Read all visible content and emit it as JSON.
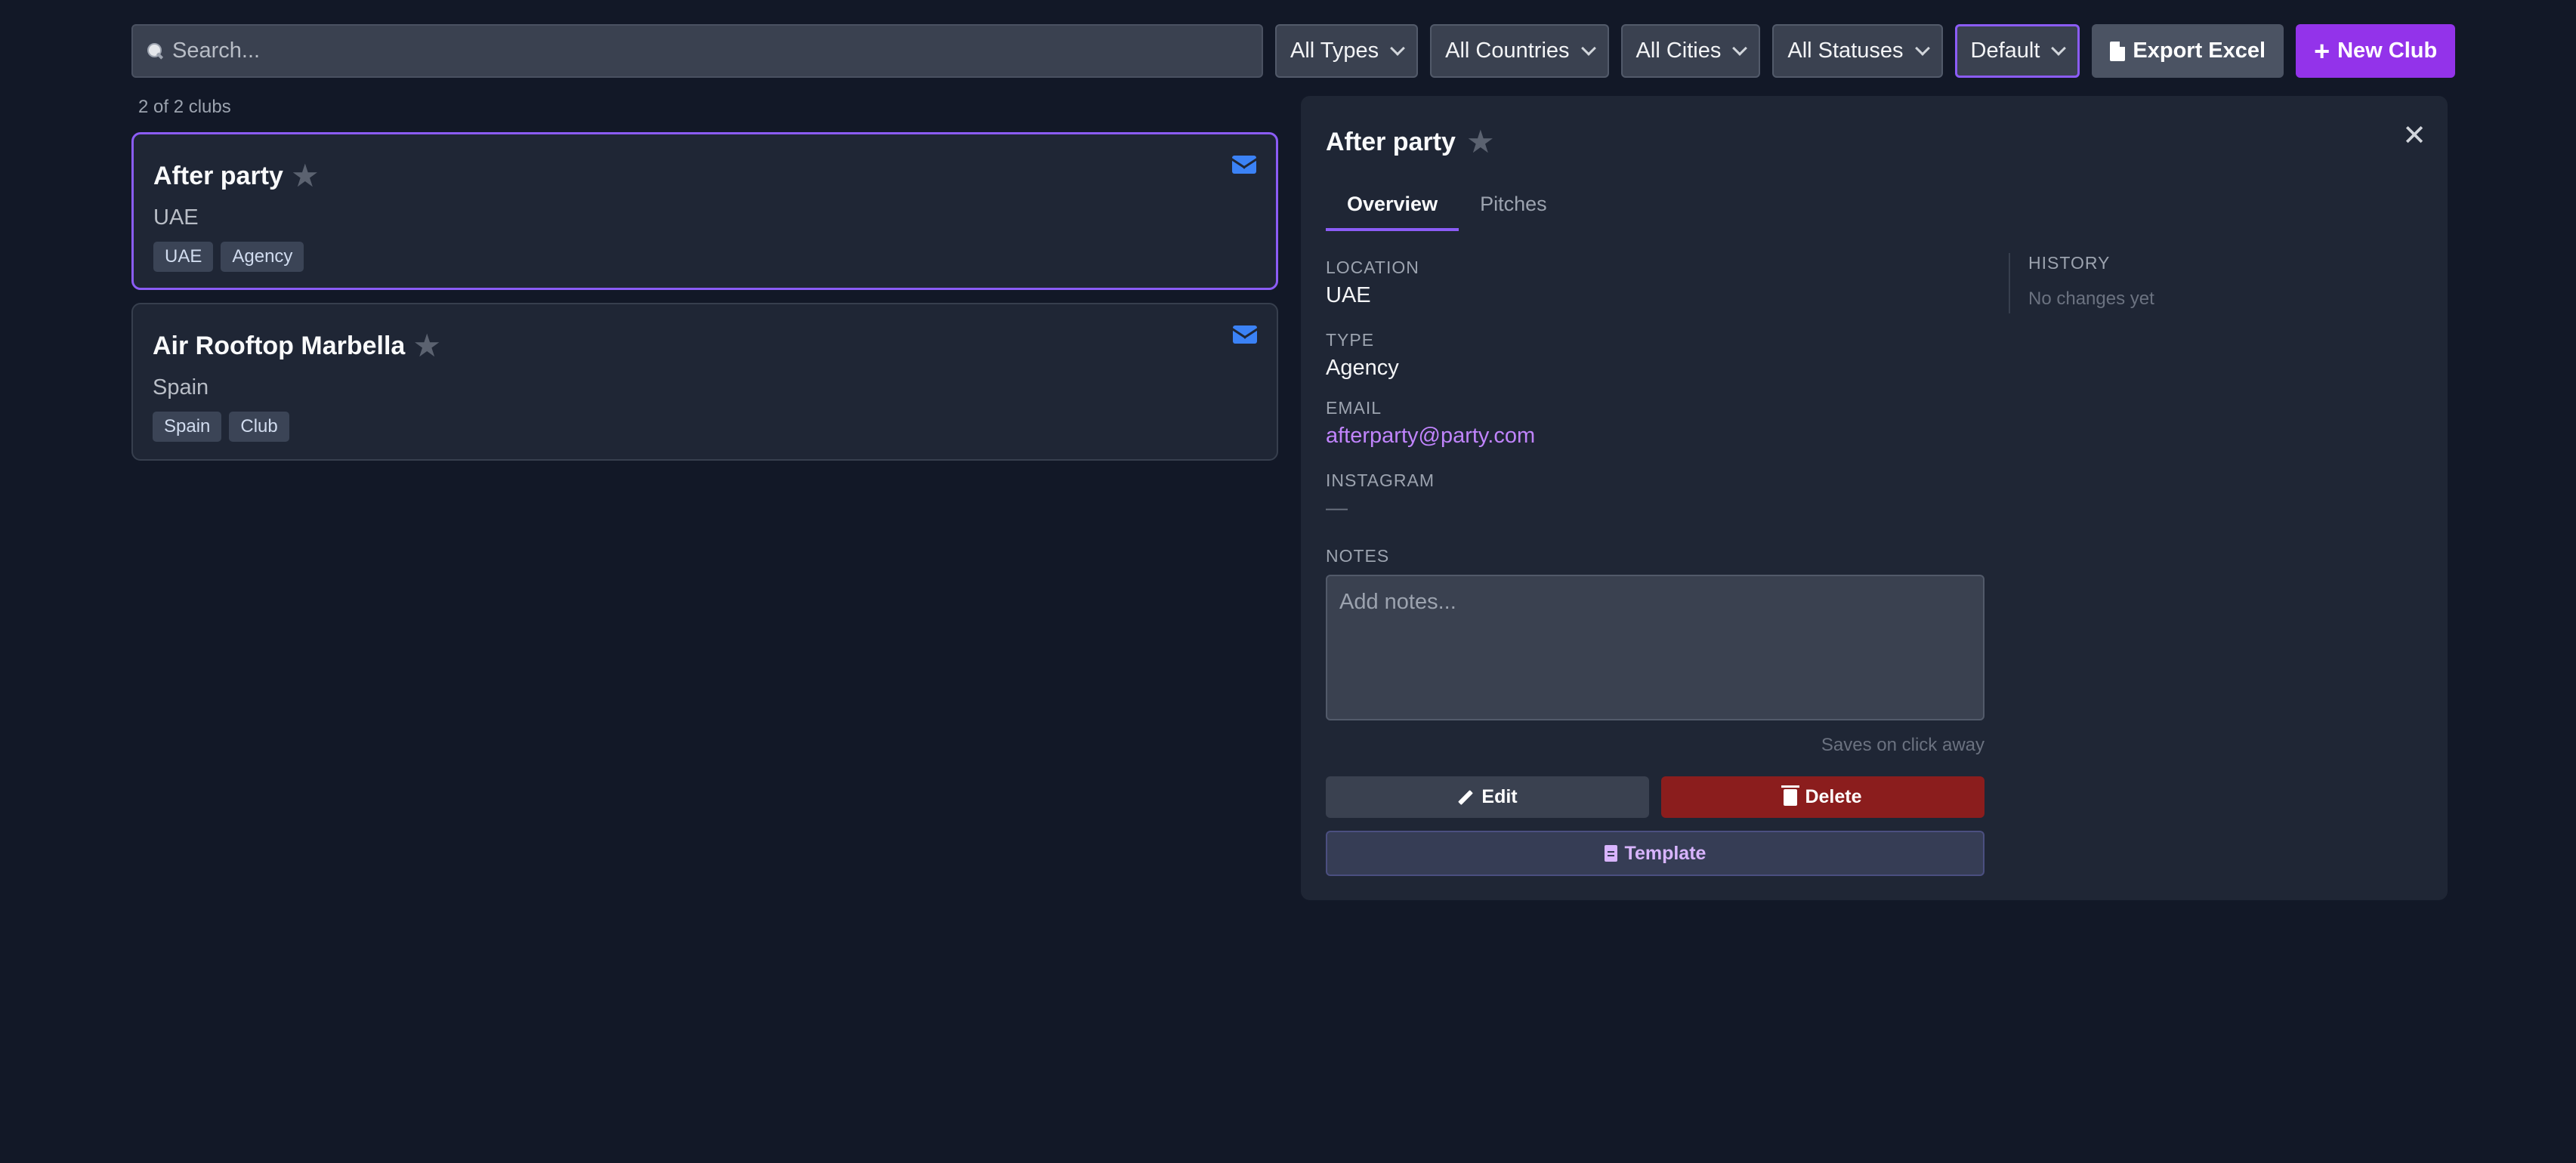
{
  "toolbar": {
    "search_placeholder": "Search...",
    "filters": {
      "types": "All Types",
      "countries": "All Countries",
      "cities": "All Cities",
      "statuses": "All Statuses",
      "sort": "Default"
    },
    "export_label": "Export Excel",
    "new_label": "New Club"
  },
  "list": {
    "count_text": "2 of 2 clubs",
    "clubs": [
      {
        "name": "After party",
        "country": "UAE",
        "tags": [
          "UAE",
          "Agency"
        ],
        "selected": true
      },
      {
        "name": "Air Rooftop Marbella",
        "country": "Spain",
        "tags": [
          "Spain",
          "Club"
        ],
        "selected": false
      }
    ]
  },
  "detail": {
    "title": "After party",
    "tabs": [
      "Overview",
      "Pitches"
    ],
    "active_tab": "Overview",
    "location_label": "LOCATION",
    "location_value": "UAE",
    "type_label": "TYPE",
    "type_value": "Agency",
    "email_label": "EMAIL",
    "email_value": "afterparty@party.com",
    "instagram_label": "INSTAGRAM",
    "instagram_value": "—",
    "notes_label": "NOTES",
    "notes_placeholder": "Add notes...",
    "saves_hint": "Saves on click away",
    "edit_label": "Edit",
    "delete_label": "Delete",
    "template_label": "Template",
    "history_label": "HISTORY",
    "history_empty": "No changes yet"
  },
  "icons": {
    "search": "magnifier-icon",
    "chevron": "chevron-down-icon",
    "export": "document-icon",
    "new": "plus-icon",
    "favorite": "star-icon",
    "mail": "mail-icon",
    "close": "close-icon",
    "edit": "pencil-icon",
    "delete": "trash-icon",
    "template": "file-text-icon"
  },
  "colors": {
    "background": "#121827",
    "panel": "#1f2635",
    "accent": "#8b5cf6",
    "primary_button": "#9333ea",
    "danger": "#8b1d1d",
    "link": "#c084fc",
    "mail_icon": "#3b82f6"
  }
}
